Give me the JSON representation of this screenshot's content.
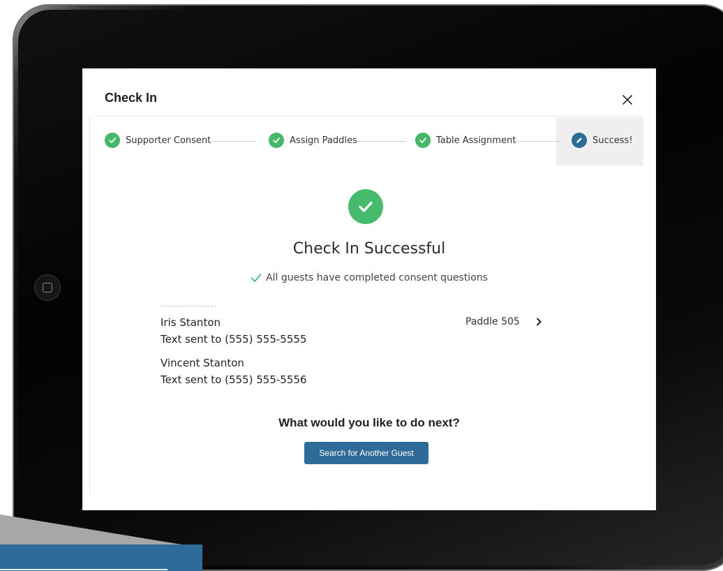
{
  "modal": {
    "title": "Check In",
    "close_icon": "close-icon"
  },
  "stepper": {
    "steps": [
      {
        "label": "Supporter Consent",
        "status": "complete",
        "icon": "check-icon"
      },
      {
        "label": "Assign Paddles",
        "status": "complete",
        "icon": "check-icon"
      },
      {
        "label": "Table Assignment",
        "status": "complete",
        "icon": "check-icon"
      },
      {
        "label": "Success!",
        "status": "active",
        "icon": "pencil-icon"
      }
    ]
  },
  "success": {
    "title": "Check In Successful",
    "consent_message": "All guests have completed consent questions"
  },
  "guests": [
    {
      "name": "Iris Stanton",
      "text_status": "Text sent to (555) 555-5555"
    },
    {
      "name": "Vincent Stanton",
      "text_status": "Text sent to (555) 555-5556"
    }
  ],
  "paddle": {
    "label": "Paddle 505"
  },
  "next": {
    "question": "What would you like to do next?",
    "search_button": "Search for Another Guest"
  },
  "colors": {
    "success_green": "#43b866",
    "primary_blue": "#2f6b98"
  }
}
